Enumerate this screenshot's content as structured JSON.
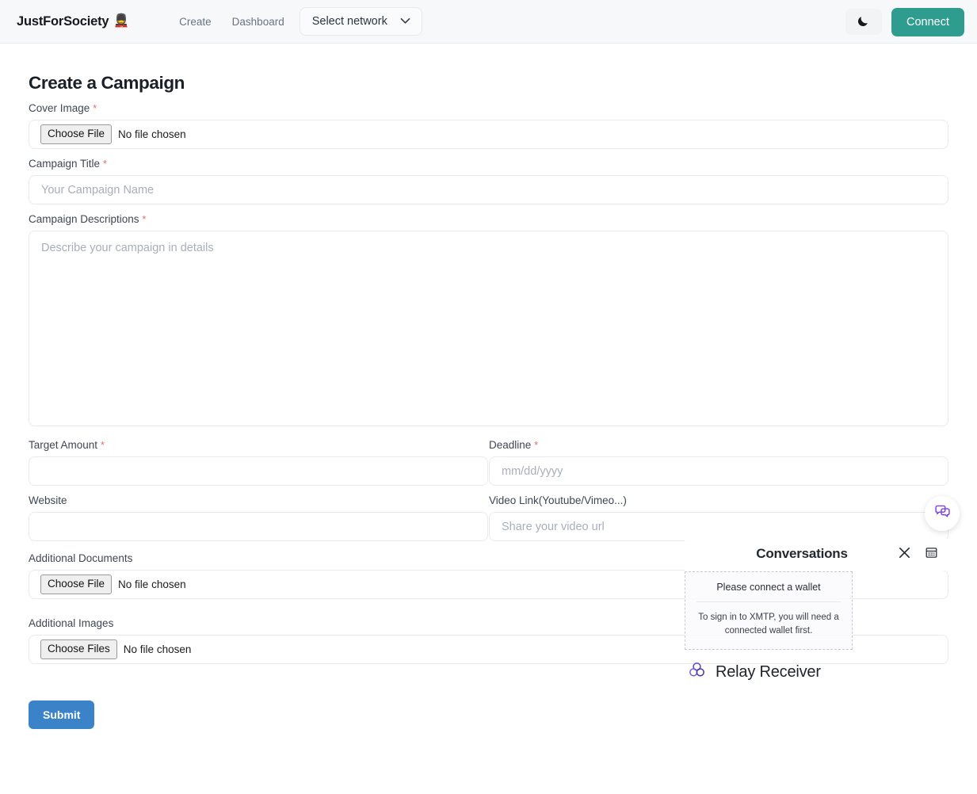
{
  "header": {
    "brand": "JustForSociety",
    "brand_emoji": "💂",
    "nav": [
      {
        "label": "Create",
        "name": "nav-link-create"
      },
      {
        "label": "Dashboard",
        "name": "nav-link-dashboard"
      }
    ],
    "network_select": {
      "value": "Select network",
      "icon": "chevron-down-icon"
    },
    "theme_toggle": {
      "icon": "moon-icon",
      "label": "Dark mode"
    },
    "connect_button": "Connect",
    "colors": {
      "connect_bg": "#2e9d90",
      "header_bg": "#f7f8fa",
      "header_border": "#e9ecef"
    }
  },
  "main": {
    "title": "Create a Campaign",
    "required_mark": "*",
    "fields": {
      "cover_image": {
        "label": "Cover Image",
        "required": true,
        "button": "Choose File",
        "status": "No file chosen"
      },
      "campaign_title": {
        "label": "Campaign Title",
        "required": true,
        "value": "",
        "placeholder": "Your Campaign Name"
      },
      "campaign_descriptions": {
        "label": "Campaign Descriptions",
        "required": true,
        "value": "",
        "placeholder": "Describe your campaign in details"
      },
      "target_amount": {
        "label": "Target Amount",
        "required": true,
        "value": "",
        "placeholder": ""
      },
      "deadline": {
        "label": "Deadline",
        "required": true,
        "value": "",
        "placeholder": "mm/dd/yyyy",
        "icon": "date-picker-pencil-icon"
      },
      "website": {
        "label": "Website",
        "required": false,
        "value": "",
        "placeholder": ""
      },
      "video_link": {
        "label": "Video Link(Youtube/Vimeo...)",
        "required": false,
        "value": "",
        "placeholder": "Share your video url"
      },
      "additional_documents": {
        "label": "Additional Documents",
        "required": false,
        "button": "Choose File",
        "status": "No file chosen"
      },
      "additional_images": {
        "label": "Additional Images",
        "required": false,
        "button": "Choose Files",
        "status": "No file chosen"
      }
    },
    "submit_button": "Submit",
    "colors": {
      "submit_bg": "#3b83c9",
      "required_star": "#e2706f"
    }
  },
  "chat_widget": {
    "launcher_icon": "chat-bubbles-icon",
    "launcher_color": "#7b3fe4",
    "panel": {
      "title": "Conversations",
      "close_icon": "close-icon",
      "window_icon": "popout-window-icon",
      "notice_title": "Please connect a wallet",
      "notice_body": "To sign in to XMTP, you will need a connected wallet first.",
      "footer_brand": "Relay Receiver",
      "footer_brand_icon": "relay-trefoil-logo",
      "footer_brand_color": "#5a45c8"
    }
  }
}
